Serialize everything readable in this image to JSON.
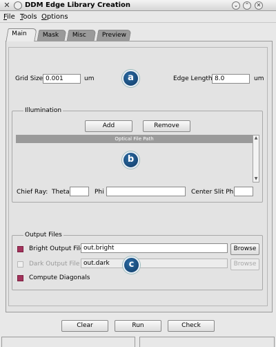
{
  "window": {
    "title": "DDM Edge Library Creation",
    "wm_close_glyph": "✕",
    "wm_min_glyph": "⌄",
    "wm_max_glyph": "⌃",
    "wm_close2_glyph": "✕"
  },
  "menubar": {
    "file_label": "File",
    "file_mnemonic": "F",
    "file_rest": "ile",
    "tools_mnemonic": "T",
    "tools_rest": "ools",
    "options_mnemonic": "O",
    "options_rest": "ptions"
  },
  "tabs": [
    {
      "label": "Main",
      "active": true
    },
    {
      "label": "Mask",
      "active": false
    },
    {
      "label": "Misc",
      "active": false
    },
    {
      "label": "Preview",
      "active": false
    }
  ],
  "grid": {
    "grid_size_label": "Grid Size",
    "grid_size_value": "0.001",
    "grid_size_unit": "um",
    "edge_length_label": "Edge Length",
    "edge_length_value": "8.0",
    "edge_length_unit": "um"
  },
  "illumination": {
    "group_title": "Illumination",
    "add_label": "Add",
    "remove_label": "Remove",
    "column_header": "Optical File Path",
    "chief_ray_label": "Chief Ray:",
    "theta_label": "Theta",
    "theta_value": "",
    "phi_label": "Phi",
    "phi_value": "",
    "center_slit_phi_label": "Center Slit Phi",
    "center_slit_phi_value": "",
    "scroll_up_glyph": "▲",
    "scroll_down_glyph": "▼"
  },
  "output": {
    "group_title": "Output Files",
    "bright_label": "Bright Output File",
    "bright_value": "out.bright",
    "bright_checked": true,
    "dark_label": "Dark Output File",
    "dark_value": "out.dark",
    "dark_checked": false,
    "browse_label": "Browse",
    "compute_diagonals_label": "Compute Diagonals",
    "compute_diagonals_checked": true
  },
  "annotations": {
    "a": "a",
    "b": "b",
    "c": "c"
  },
  "footer": {
    "clear_label": "Clear",
    "run_label": "Run",
    "check_label": "Check"
  },
  "colors": {
    "checkbox_checked": "#a3335c",
    "badge": "#0e3b66",
    "list_header": "#9a9a9a"
  }
}
